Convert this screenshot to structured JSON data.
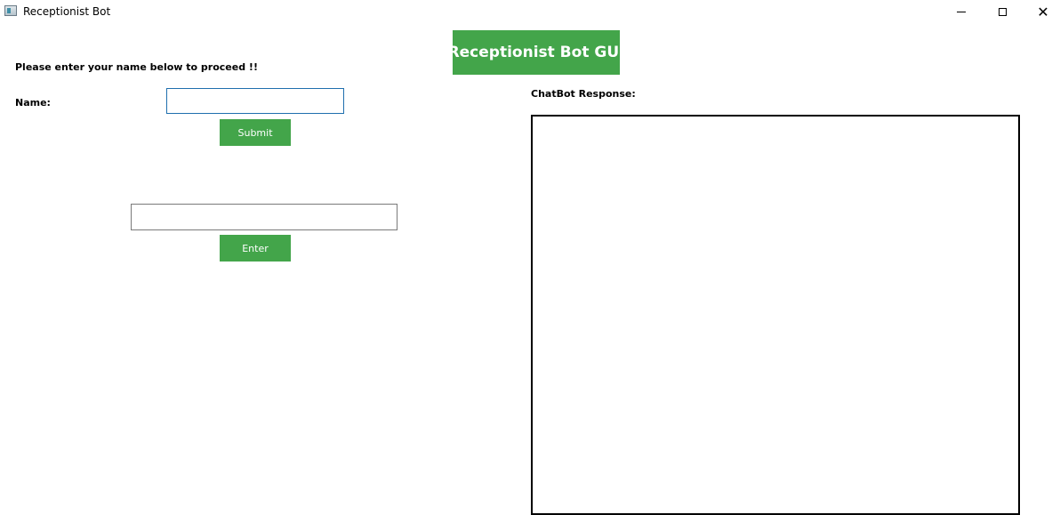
{
  "window": {
    "title": "Receptionist Bot",
    "minimize_glyph": "minimize-icon",
    "maximize_glyph": "maximize-icon",
    "close_glyph": "✕"
  },
  "header": {
    "banner": "Receptionist Bot GUI"
  },
  "form": {
    "prompt": "Please enter your name below to proceed !!",
    "name_label": "Name:",
    "name_value": "",
    "submit_label": "Submit",
    "message_value": "",
    "enter_label": "Enter"
  },
  "chat": {
    "response_label": "ChatBot Response:",
    "response_text": ""
  },
  "colors": {
    "accent_green": "#43a54a",
    "focus_border": "#1f6fae"
  }
}
